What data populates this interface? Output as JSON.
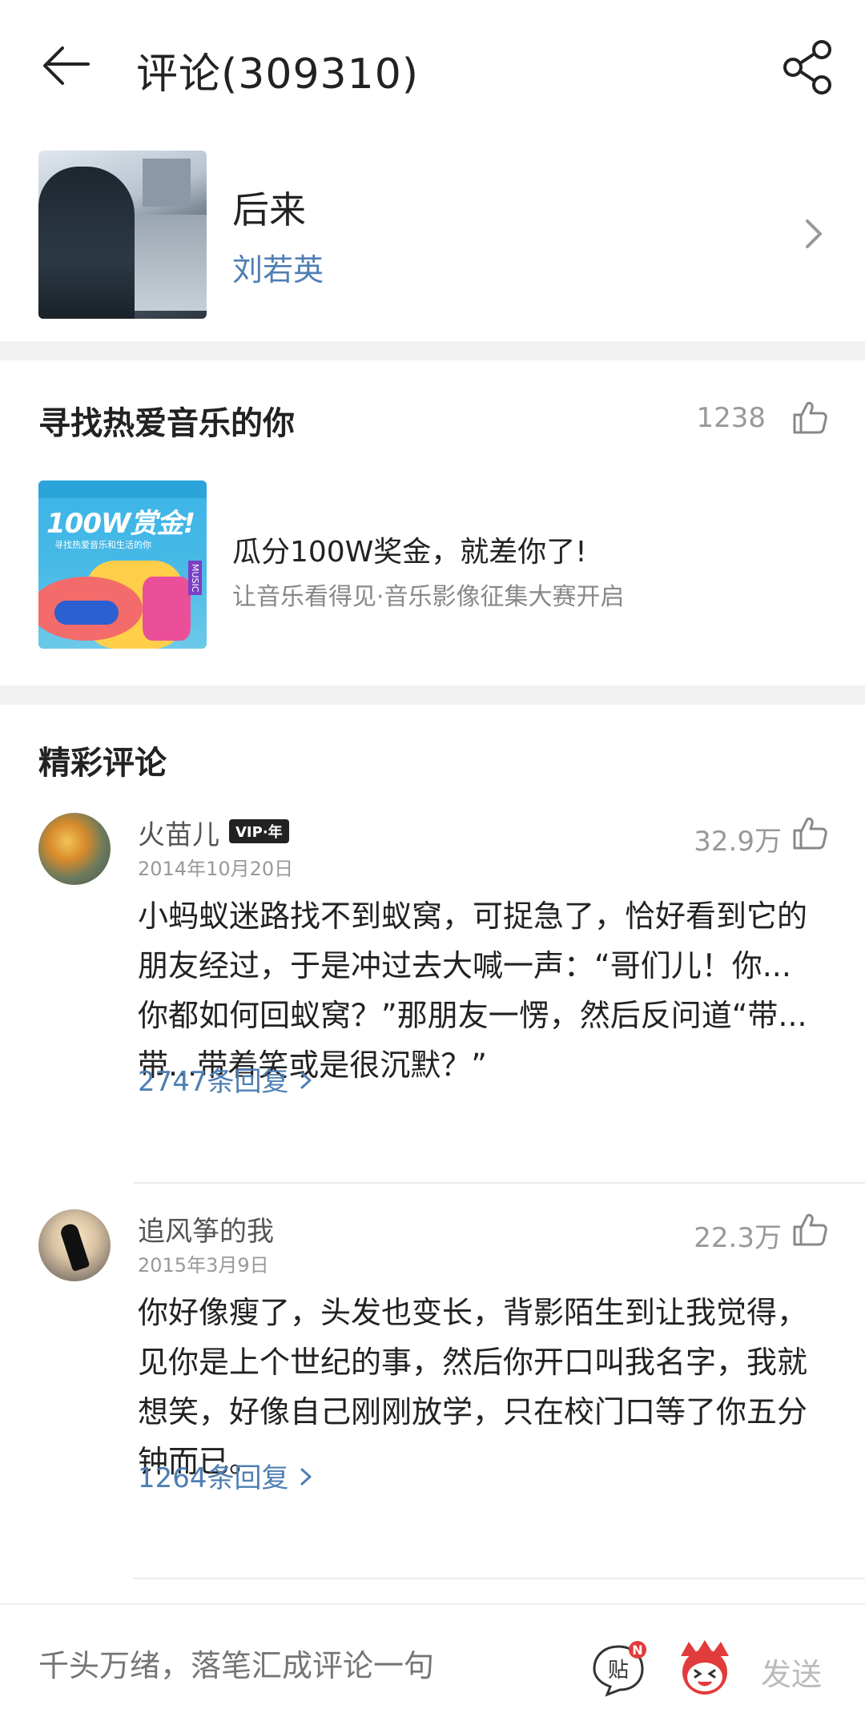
{
  "header": {
    "title": "评论(309310)"
  },
  "song": {
    "title": "后来",
    "artist": "刘若英"
  },
  "topic": {
    "heading": "寻找热爱音乐的你",
    "likes": "1238",
    "promo_image_big": "100W赏金!",
    "promo_image_sub": "寻找热爱音乐和生活的你",
    "promo_image_tag": "MUSIC",
    "promo_title": "瓜分100W奖金，就差你了!",
    "promo_subtitle": "让音乐看得见·音乐影像征集大赛开启"
  },
  "comments_section": {
    "heading": "精彩评论",
    "items": [
      {
        "username": "火苗儿",
        "vip": "VIP·年",
        "date": "2014年10月20日",
        "likes": "32.9万",
        "text": "小蚂蚁迷路找不到蚁窝，可捉急了，恰好看到它的朋友经过，于是冲过去大喊一声：“哥们儿！你...你都如何回蚁窝？”那朋友一愣，然后反问道“带...带...带着笑或是很沉默？”",
        "replies": "2747条回复"
      },
      {
        "username": "追风筝的我",
        "date": "2015年3月9日",
        "likes": "22.3万",
        "text": "你好像瘦了，头发也变长，背影陌生到让我觉得，见你是上个世纪的事，然后你开口叫我名字，我就想笑，好像自己刚刚放学，只在校门口等了你五分钟而已。",
        "replies": "1264条回复"
      }
    ]
  },
  "bottom_bar": {
    "input_placeholder": "千头万绪，落笔汇成评论一句",
    "tie_label": "贴",
    "tie_badge": "N",
    "send_label": "发送"
  }
}
